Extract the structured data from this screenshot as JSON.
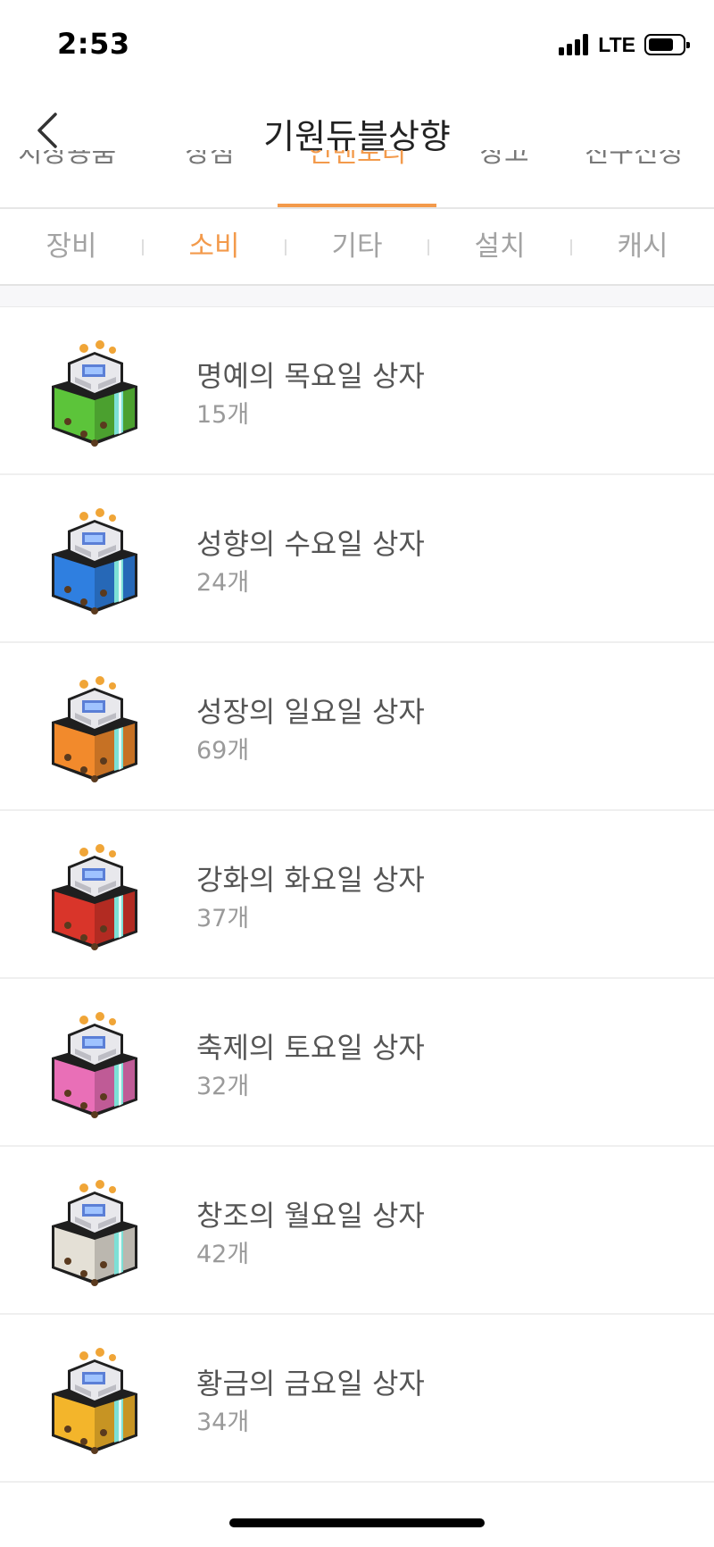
{
  "status_bar": {
    "time": "2:53",
    "network": "LTE"
  },
  "nav": {
    "title": "기원듀블상향",
    "back_icon": "chevron-left-icon"
  },
  "primary_tabs": [
    {
      "label": "치장용품"
    },
    {
      "label": "상점"
    },
    {
      "label": "인벤토리",
      "active": true
    },
    {
      "label": "창고"
    },
    {
      "label": "친구신청"
    }
  ],
  "sub_tabs": [
    {
      "label": "장비"
    },
    {
      "label": "소비",
      "active": true
    },
    {
      "label": "기타"
    },
    {
      "label": "설치"
    },
    {
      "label": "캐시"
    }
  ],
  "colors": {
    "accent": "#f39a4b",
    "inactive_tab": "#a3a3a3"
  },
  "items": [
    {
      "name": "명예의 목요일 상자",
      "count": "15개",
      "icon": "green-gift-box-icon",
      "color": "#5cc43a"
    },
    {
      "name": "성향의 수요일 상자",
      "count": "24개",
      "icon": "blue-gift-box-icon",
      "color": "#2f7fe0"
    },
    {
      "name": "성장의 일요일 상자",
      "count": "69개",
      "icon": "orange-gift-box-icon",
      "color": "#f28a2c"
    },
    {
      "name": "강화의 화요일 상자",
      "count": "37개",
      "icon": "red-gift-box-icon",
      "color": "#d9352a"
    },
    {
      "name": "축제의 토요일 상자",
      "count": "32개",
      "icon": "pink-gift-box-icon",
      "color": "#e96fb7"
    },
    {
      "name": "창조의 월요일 상자",
      "count": "42개",
      "icon": "white-gift-box-icon",
      "color": "#e4e0d6"
    },
    {
      "name": "황금의 금요일 상자",
      "count": "34개",
      "icon": "gold-gift-box-icon",
      "color": "#f3b52b"
    }
  ]
}
